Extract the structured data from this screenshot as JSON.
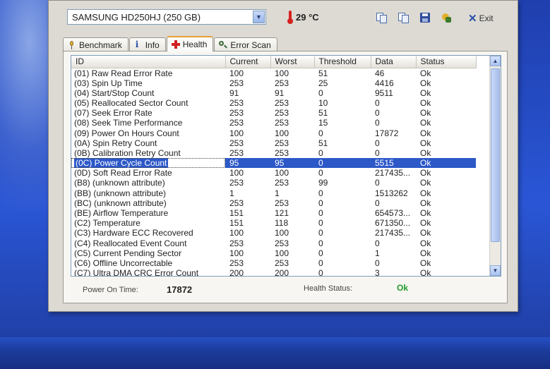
{
  "toolbar": {
    "drive": "SAMSUNG HD250HJ (250 GB)",
    "temperature": "29 °C",
    "exit_label": "Exit"
  },
  "tabs": [
    {
      "label": "Benchmark",
      "icon": "benchmark-icon"
    },
    {
      "label": "Info",
      "icon": "info-icon"
    },
    {
      "label": "Health",
      "icon": "health-icon",
      "active": true
    },
    {
      "label": "Error Scan",
      "icon": "error-scan-icon"
    }
  ],
  "columns": [
    "ID",
    "Current",
    "Worst",
    "Threshold",
    "Data",
    "Status"
  ],
  "rows": [
    {
      "id": "(01) Raw Read Error Rate",
      "current": "100",
      "worst": "100",
      "threshold": "51",
      "data": "46",
      "status": "Ok"
    },
    {
      "id": "(03) Spin Up Time",
      "current": "253",
      "worst": "253",
      "threshold": "25",
      "data": "4416",
      "status": "Ok"
    },
    {
      "id": "(04) Start/Stop Count",
      "current": "91",
      "worst": "91",
      "threshold": "0",
      "data": "9511",
      "status": "Ok"
    },
    {
      "id": "(05) Reallocated Sector Count",
      "current": "253",
      "worst": "253",
      "threshold": "10",
      "data": "0",
      "status": "Ok"
    },
    {
      "id": "(07) Seek Error Rate",
      "current": "253",
      "worst": "253",
      "threshold": "51",
      "data": "0",
      "status": "Ok"
    },
    {
      "id": "(08) Seek Time Performance",
      "current": "253",
      "worst": "253",
      "threshold": "15",
      "data": "0",
      "status": "Ok"
    },
    {
      "id": "(09) Power On Hours Count",
      "current": "100",
      "worst": "100",
      "threshold": "0",
      "data": "17872",
      "status": "Ok"
    },
    {
      "id": "(0A) Spin Retry Count",
      "current": "253",
      "worst": "253",
      "threshold": "51",
      "data": "0",
      "status": "Ok"
    },
    {
      "id": "(0B) Calibration Retry Count",
      "current": "253",
      "worst": "253",
      "threshold": "0",
      "data": "0",
      "status": "Ok"
    },
    {
      "id": "(0C) Power Cycle Count",
      "current": "95",
      "worst": "95",
      "threshold": "0",
      "data": "5515",
      "status": "Ok",
      "selected": true
    },
    {
      "id": "(0D) Soft Read Error Rate",
      "current": "100",
      "worst": "100",
      "threshold": "0",
      "data": "217435...",
      "status": "Ok"
    },
    {
      "id": "(B8) (unknown attribute)",
      "current": "253",
      "worst": "253",
      "threshold": "99",
      "data": "0",
      "status": "Ok"
    },
    {
      "id": "(BB) (unknown attribute)",
      "current": "1",
      "worst": "1",
      "threshold": "0",
      "data": "1513262",
      "status": "Ok"
    },
    {
      "id": "(BC) (unknown attribute)",
      "current": "253",
      "worst": "253",
      "threshold": "0",
      "data": "0",
      "status": "Ok"
    },
    {
      "id": "(BE) Airflow Temperature",
      "current": "151",
      "worst": "121",
      "threshold": "0",
      "data": "654573...",
      "status": "Ok"
    },
    {
      "id": "(C2) Temperature",
      "current": "151",
      "worst": "118",
      "threshold": "0",
      "data": "671350...",
      "status": "Ok"
    },
    {
      "id": "(C3) Hardware ECC Recovered",
      "current": "100",
      "worst": "100",
      "threshold": "0",
      "data": "217435...",
      "status": "Ok"
    },
    {
      "id": "(C4) Reallocated Event Count",
      "current": "253",
      "worst": "253",
      "threshold": "0",
      "data": "0",
      "status": "Ok"
    },
    {
      "id": "(C5) Current Pending Sector",
      "current": "100",
      "worst": "100",
      "threshold": "0",
      "data": "1",
      "status": "Ok"
    },
    {
      "id": "(C6) Offline Uncorrectable",
      "current": "253",
      "worst": "253",
      "threshold": "0",
      "data": "0",
      "status": "Ok"
    },
    {
      "id": "(C7) Ultra DMA CRC Error Count",
      "current": "200",
      "worst": "200",
      "threshold": "0",
      "data": "3",
      "status": "Ok"
    }
  ],
  "footer": {
    "power_on_label": "Power On Time:",
    "power_on_value": "17872",
    "health_label": "Health Status:",
    "health_value": "Ok"
  },
  "colors": {
    "selection": "#2c58c8",
    "health_ok": "#1f9a2a",
    "accent_tab": "#e8a23a",
    "desktop": "#2a56d6"
  }
}
